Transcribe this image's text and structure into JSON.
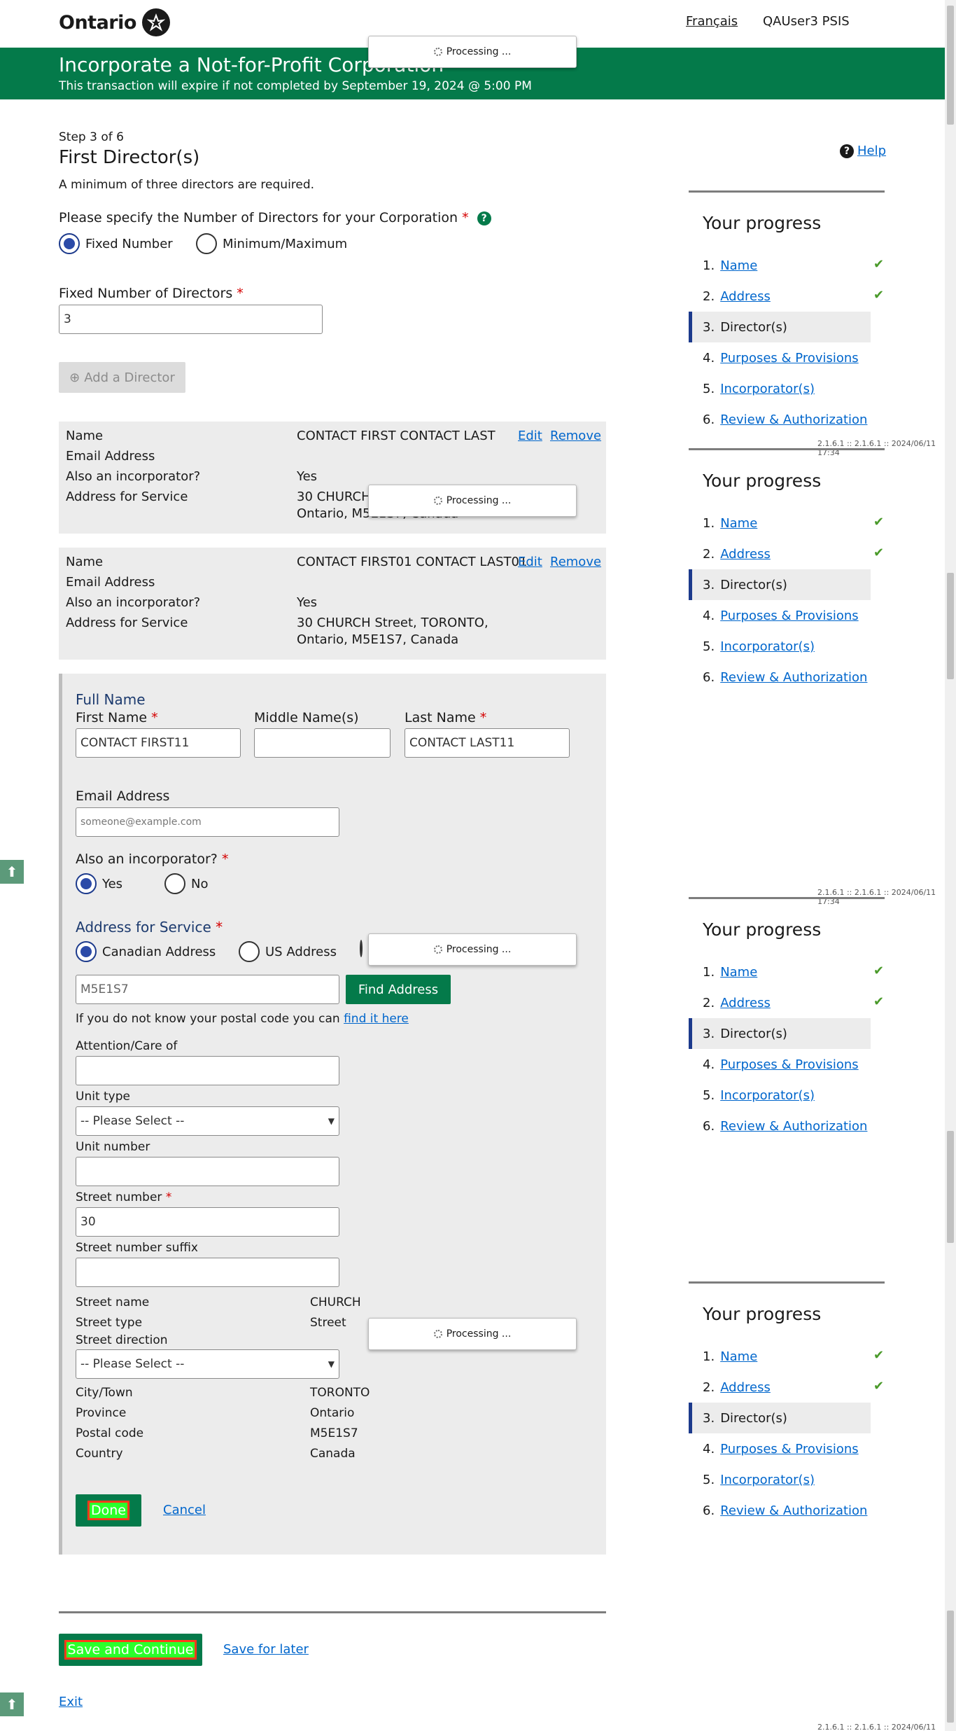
{
  "header": {
    "logo_text": "Ontario",
    "language_link": "Français",
    "user_name": "QAUser3 PSIS"
  },
  "banner": {
    "title": "Incorporate a Not-for-Profit Corporation",
    "subtitle": "This transaction will expire if not completed by September 19, 2024 @ 5:00 PM"
  },
  "page": {
    "step": "Step 3 of 6",
    "title": "First Director(s)",
    "min_note": "A minimum of three directors are required.",
    "help_label": "Help"
  },
  "num_directors": {
    "question": "Please specify the Number of Directors for your Corporation",
    "options": [
      "Fixed Number",
      "Minimum/Maximum"
    ],
    "selected": "Fixed Number",
    "fixed_label": "Fixed Number of Directors",
    "fixed_value": "3",
    "add_button": "Add a Director"
  },
  "directors": [
    {
      "labels": {
        "name": "Name",
        "email": "Email Address",
        "incorporator": "Also an incorporator?",
        "address": "Address for Service"
      },
      "name": "CONTACT FIRST CONTACT LAST",
      "incorporator": "Yes",
      "address_line1": "30 CHURCH",
      "address_line2": "Ontario, M5E1S7, Canada",
      "edit": "Edit",
      "remove": "Remove"
    },
    {
      "labels": {
        "name": "Name",
        "email": "Email Address",
        "incorporator": "Also an incorporator?",
        "address": "Address for Service"
      },
      "name": "CONTACT FIRST01 CONTACT LAST01",
      "incorporator": "Yes",
      "address_line1": "30 CHURCH Street, TORONTO,",
      "address_line2": "Ontario, M5E1S7, Canada",
      "edit": "Edit",
      "remove": "Remove"
    }
  ],
  "form": {
    "full_name_heading": "Full Name",
    "first_name_label": "First Name",
    "first_name_value": "CONTACT FIRST11",
    "middle_name_label": "Middle Name(s)",
    "middle_name_value": "",
    "last_name_label": "Last Name",
    "last_name_value": "CONTACT LAST11",
    "email_label": "Email Address",
    "email_placeholder": "someone@example.com",
    "incorporator_label": "Also an incorporator?",
    "incorporator_options": [
      "Yes",
      "No"
    ],
    "incorporator_selected": "Yes",
    "address_heading": "Address for Service",
    "address_options": [
      "Canadian Address",
      "US Address"
    ],
    "address_selected": "Canadian Address",
    "postal_value": "M5E1S7",
    "find_address_button": "Find Address",
    "postal_hint": "If you do not know your postal code you can",
    "postal_hint_link": "find it here",
    "attention_label": "Attention/Care of",
    "unit_type_label": "Unit type",
    "unit_type_value": "-- Please Select --",
    "unit_number_label": "Unit number",
    "street_number_label": "Street number",
    "street_number_value": "30",
    "street_suffix_label": "Street number suffix",
    "street_name_label": "Street name",
    "street_name_value": "CHURCH",
    "street_type_label": "Street type",
    "street_type_value": "Street",
    "street_direction_label": "Street direction",
    "street_direction_value": "-- Please Select --",
    "city_label": "City/Town",
    "city_value": "TORONTO",
    "province_label": "Province",
    "province_value": "Ontario",
    "postal_label": "Postal code",
    "postal_code_value": "M5E1S7",
    "country_label": "Country",
    "country_value": "Canada",
    "done_button": "Done",
    "cancel_link": "Cancel"
  },
  "footer": {
    "save_continue": "Save and Continue",
    "save_later": "Save for later",
    "exit": "Exit"
  },
  "progress": {
    "title": "Your progress",
    "items": [
      {
        "num": "1.",
        "label": "Name",
        "done": true
      },
      {
        "num": "2.",
        "label": "Address",
        "done": true
      },
      {
        "num": "3.",
        "label": "Director(s)",
        "current": true
      },
      {
        "num": "4.",
        "label": "Purposes & Provisions"
      },
      {
        "num": "5.",
        "label": "Incorporator(s)"
      },
      {
        "num": "6.",
        "label": "Review & Authorization"
      }
    ],
    "version": "2.1.6.1 :: 2.1.6.1 :: 2024/06/11 17:34"
  },
  "processing_text": "Processing ...",
  "colors": {
    "brand_green": "#047a4a",
    "link_blue": "#0066cc",
    "current_step_bar": "#1c3a8c",
    "check_green": "#4a9a2a",
    "required_red": "#d40000"
  }
}
